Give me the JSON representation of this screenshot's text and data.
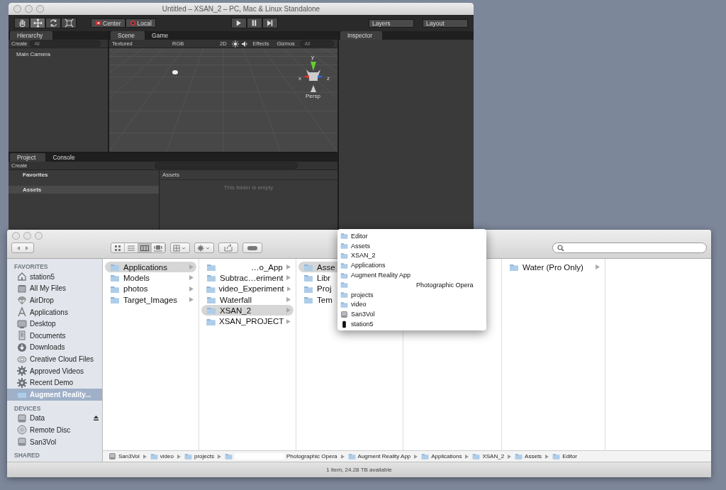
{
  "unity_window": {
    "title": "Untitled – XSAN_2 – PC, Mac & Linux Standalone",
    "tools": [
      {
        "kind": "hand",
        "selected": false
      },
      {
        "kind": "move",
        "selected": true
      },
      {
        "kind": "rotate",
        "selected": false
      },
      {
        "kind": "scale",
        "selected": false
      }
    ],
    "pivot_buttons": [
      {
        "kind": "pivot",
        "label": "Center"
      },
      {
        "kind": "local",
        "label": "Local"
      }
    ],
    "play_controls": [
      {
        "kind": "play"
      },
      {
        "kind": "pause"
      },
      {
        "kind": "step"
      }
    ],
    "layers": "Layers",
    "layout": "Layout",
    "hierarchy": {
      "tab": "Hierarchy",
      "create": "Create",
      "search_placeholder": "All",
      "items": [
        "Main Camera"
      ]
    },
    "scene": {
      "tabs": [
        {
          "label": "Scene",
          "selected": true
        },
        {
          "label": "Game",
          "selected": false
        }
      ],
      "shading": "Textured",
      "render_mode": "RGB",
      "mode_2d": "2D",
      "effects": "Effects",
      "gizmos": "Gizmos",
      "search_placeholder": "All",
      "axes": [
        "y",
        "x",
        "z"
      ],
      "projection": "Persp"
    },
    "inspector": {
      "tab": "Inspector"
    },
    "project": {
      "tabs": [
        {
          "label": "Project",
          "selected": true
        },
        {
          "label": "Console",
          "selected": false
        }
      ],
      "create": "Create",
      "favorites": "Favorites",
      "folders": [
        {
          "label": "Assets",
          "selected": true
        }
      ],
      "breadcrumb": "Assets",
      "empty_message": "This folder is empty"
    }
  },
  "finder_window": {
    "view_modes": [
      {
        "kind": "icon",
        "selected": false
      },
      {
        "kind": "list",
        "selected": false
      },
      {
        "kind": "column",
        "selected": true
      },
      {
        "kind": "coverflow",
        "selected": false
      }
    ],
    "sidebar": [
      {
        "heading": "FAVORITES",
        "items": [
          {
            "label": "station5",
            "kind": "home",
            "selected": false
          },
          {
            "label": "All My Files",
            "kind": "files",
            "selected": false
          },
          {
            "label": "AirDrop",
            "kind": "airdrop",
            "selected": false
          },
          {
            "label": "Applications",
            "kind": "apps",
            "selected": false
          },
          {
            "label": "Desktop",
            "kind": "desktop",
            "selected": false
          },
          {
            "label": "Documents",
            "kind": "documents",
            "selected": false
          },
          {
            "label": "Downloads",
            "kind": "download",
            "selected": false
          },
          {
            "label": "Creative Cloud Files",
            "kind": "cloud",
            "selected": false
          },
          {
            "label": "Approved Videos",
            "kind": "gear",
            "selected": false
          },
          {
            "label": "Recent Demo",
            "kind": "gear",
            "selected": false
          },
          {
            "label": "Augment Reality...",
            "kind": "folder",
            "selected": true
          }
        ]
      },
      {
        "heading": "DEVICES",
        "items": [
          {
            "label": "Data",
            "kind": "disk",
            "selected": false,
            "ejectable": true
          },
          {
            "label": "Remote Disc",
            "kind": "disc",
            "selected": false,
            "ejectable": false
          },
          {
            "label": "San3Vol",
            "kind": "disk",
            "selected": false,
            "ejectable": false
          }
        ]
      },
      {
        "heading": "SHARED"
      }
    ],
    "columns": [
      {
        "items": [
          {
            "label": "Applications",
            "selected": true
          },
          {
            "label": "Models",
            "selected": false
          },
          {
            "label": "photos",
            "selected": false
          },
          {
            "label": "Target_Images",
            "selected": false
          }
        ]
      },
      {
        "items": [
          {
            "label": "…o_App",
            "selected": false,
            "redacted": true
          },
          {
            "label": "Subtrac…eriment",
            "selected": false
          },
          {
            "label": "video_Experiment",
            "selected": false
          },
          {
            "label": "Waterfall",
            "selected": false
          },
          {
            "label": "XSAN_2",
            "selected": true
          },
          {
            "label": "XSAN_PROJECT",
            "selected": false
          }
        ]
      },
      {
        "items": [
          {
            "label": "Asse",
            "selected": true
          },
          {
            "label": "Libr",
            "selected": false
          },
          {
            "label": "Proj",
            "selected": false
          },
          {
            "label": "Tem",
            "selected": false
          }
        ]
      },
      {},
      {
        "items": [
          {
            "label": "Water (Pro Only)",
            "selected": false
          }
        ]
      },
      {}
    ],
    "path": [
      {
        "label": "San3Vol",
        "kind": "disk"
      },
      {
        "label": "video",
        "kind": "folder"
      },
      {
        "label": "projects",
        "kind": "folder"
      },
      {
        "label": "Photographic Opera",
        "kind": "folder",
        "redacted": true
      },
      {
        "label": "Augment Reality App",
        "kind": "folder"
      },
      {
        "label": "Applications",
        "kind": "folder"
      },
      {
        "label": "XSAN_2",
        "kind": "folder"
      },
      {
        "label": "Assets",
        "kind": "folder"
      },
      {
        "label": "Editor",
        "kind": "folder"
      }
    ],
    "status": "1 item, 24.28 TB available"
  },
  "path_popup": {
    "items": [
      {
        "label": "Editor",
        "kind": "folder"
      },
      {
        "label": "Assets",
        "kind": "folder"
      },
      {
        "label": "XSAN_2",
        "kind": "folder"
      },
      {
        "label": "Applications",
        "kind": "folder"
      },
      {
        "label": "Augment Reality App",
        "kind": "folder"
      },
      {
        "label": "Photographic Opera",
        "kind": "folder",
        "redacted": true
      },
      {
        "label": "projects",
        "kind": "folder"
      },
      {
        "label": "video",
        "kind": "folder"
      },
      {
        "label": "San3Vol",
        "kind": "disk"
      },
      {
        "label": "station5",
        "kind": "drive"
      }
    ]
  }
}
